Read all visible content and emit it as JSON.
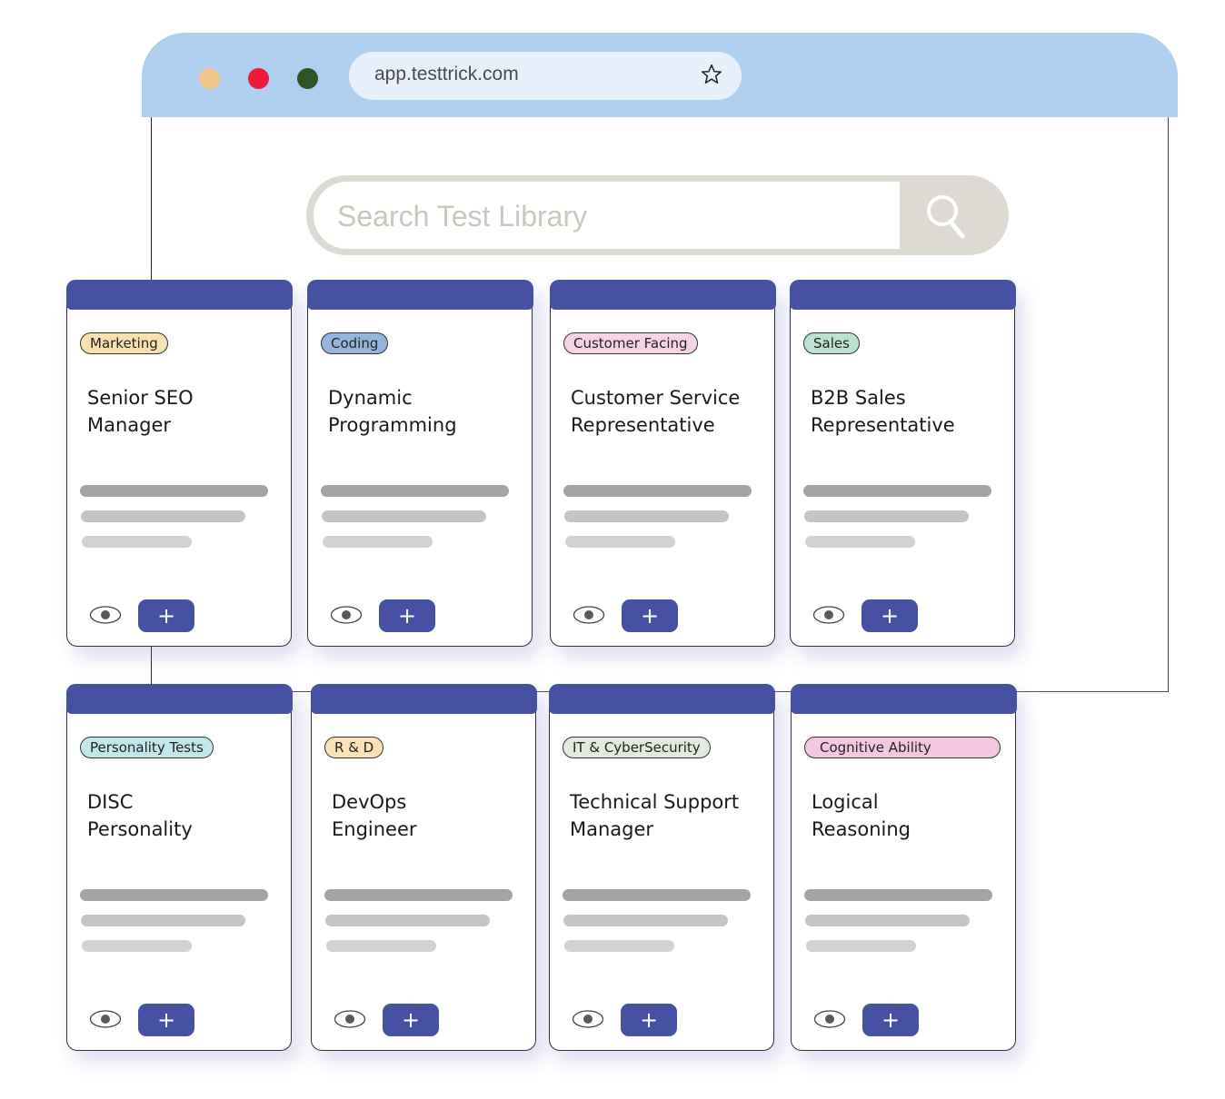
{
  "browser": {
    "url": "app.testtrick.com",
    "traffic_lights": [
      "#f1c487",
      "#ea1b3c",
      "#2f5227"
    ],
    "bookmark_icon": "star-icon",
    "titlebar_color": "#aecfee"
  },
  "search": {
    "placeholder": "Search Test Library",
    "value": "",
    "button_icon": "search-icon"
  },
  "theme": {
    "accent": "#4651a3",
    "card_header": "#4651a3"
  },
  "cards": [
    {
      "tag": "Marketing",
      "tag_color": "#f8e1b1",
      "title_line1": "Senior SEO",
      "title_line2": "Manager",
      "view_icon": "eye-icon",
      "add_label": "+"
    },
    {
      "tag": "Coding",
      "tag_color": "#95b4da",
      "title_line1": "Dynamic",
      "title_line2": "Programming",
      "view_icon": "eye-icon",
      "add_label": "+"
    },
    {
      "tag": "Customer Facing",
      "tag_color": "#f4d3e4",
      "title_line1": "Customer Service",
      "title_line2": "Representative",
      "view_icon": "eye-icon",
      "add_label": "+"
    },
    {
      "tag": "Sales",
      "tag_color": "#bde2d2",
      "title_line1": "B2B Sales",
      "title_line2": "Representative",
      "view_icon": "eye-icon",
      "add_label": "+"
    },
    {
      "tag": "Personality Tests",
      "tag_color": "#c3e6ea",
      "title_line1": "DISC",
      "title_line2": "Personality",
      "view_icon": "eye-icon",
      "add_label": "+"
    },
    {
      "tag": "R & D",
      "tag_color": "#fae3b9",
      "title_line1": "DevOps",
      "title_line2": "Engineer",
      "view_icon": "eye-icon",
      "add_label": "+"
    },
    {
      "tag": "IT & CyberSecurity",
      "tag_color": "#e3e9dc",
      "title_line1": "Technical Support",
      "title_line2": "Manager",
      "view_icon": "eye-icon",
      "add_label": "+"
    },
    {
      "tag": "Cognitive Ability",
      "tag_color": "#f2c7df",
      "title_line1": "Logical",
      "title_line2": "Reasoning",
      "view_icon": "eye-icon",
      "add_label": "+"
    }
  ]
}
